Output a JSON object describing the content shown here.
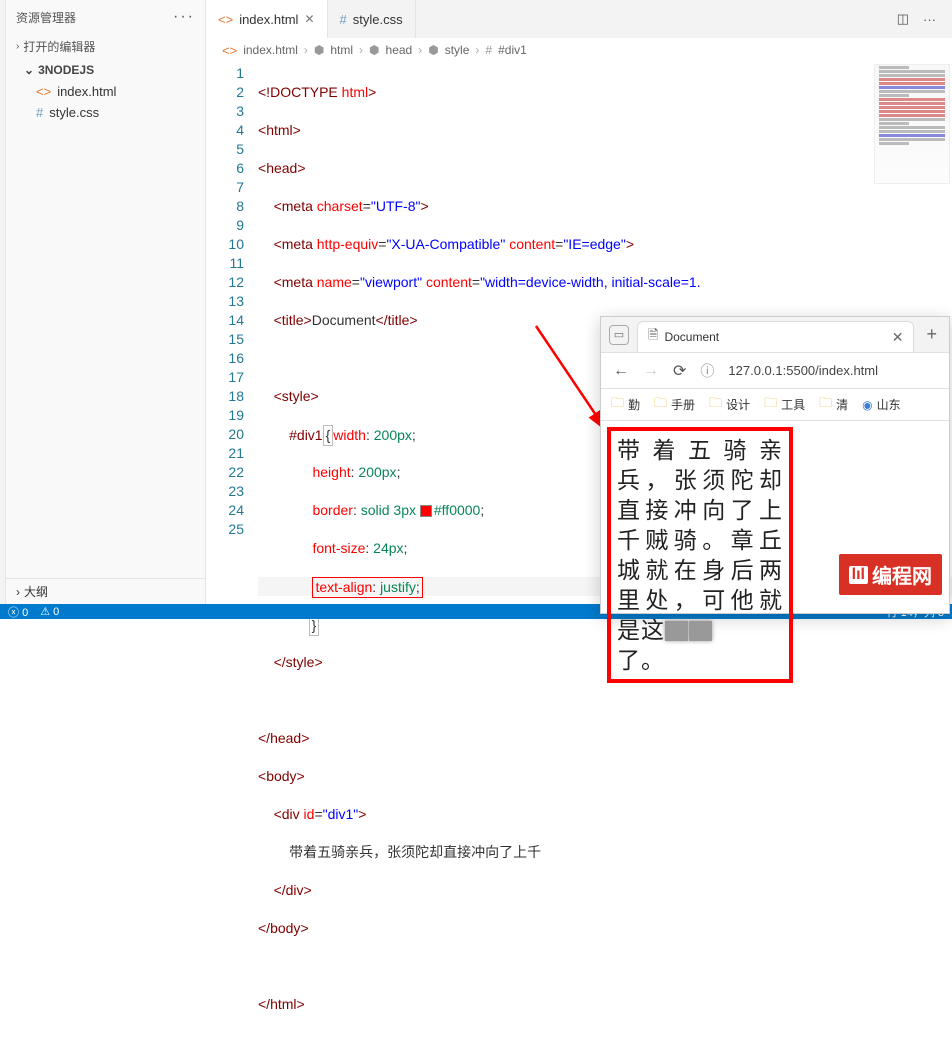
{
  "sidebar": {
    "title": "资源管理器",
    "open_editors": "打开的编辑器",
    "folder": "3NODEJS",
    "files": [
      {
        "name": "index.html",
        "icon": "<>"
      },
      {
        "name": "style.css",
        "icon": "#"
      }
    ],
    "outline": "大纲"
  },
  "tabs": [
    {
      "label": "index.html",
      "icon": "<>",
      "active": true
    },
    {
      "label": "style.css",
      "icon": "#",
      "active": false
    }
  ],
  "breadcrumb": [
    "index.html",
    "html",
    "head",
    "style",
    "#div1"
  ],
  "editor": {
    "code": {
      "l1": "<!DOCTYPE html>",
      "l2": "<html>",
      "l3": "<head>",
      "l4_meta_attr": "charset",
      "l4_meta_val": "\"UTF-8\"",
      "l5_attr1": "http-equiv",
      "l5_val1": "\"X-UA-Compatible\"",
      "l5_attr2": "content",
      "l5_val2": "\"IE=edge\"",
      "l6_attr1": "name",
      "l6_val1": "\"viewport\"",
      "l6_attr2": "content",
      "l6_val2": "\"width=device-width, initial-scale=1.",
      "l7_title": "Document",
      "l10_sel": "#div1",
      "l10_p": "width",
      "l10_v": "200px",
      "l11_p": "height",
      "l11_v": "200px",
      "l12_p": "border",
      "l12_v1": "solid",
      "l12_v2": "3px",
      "l12_v3": "#ff0000",
      "l13_p": "font-size",
      "l13_v": "24px",
      "l14_p": "text-align",
      "l14_v": "justify",
      "l20_attr": "id",
      "l20_val": "\"div1\"",
      "l21_text": "带着五骑亲兵，张须陀却直接冲向了上千"
    }
  },
  "browser": {
    "tab_title": "Document",
    "url": "127.0.0.1:5500/index.html",
    "bookmarks": [
      "勤",
      "手册",
      "设计",
      "工具",
      "清",
      "山东"
    ],
    "content": "带着五骑亲兵，张须陀却直接冲向了上千贼骑。章丘城就在身后两里处，可他就是这",
    "content_last": "了。"
  },
  "statusbar": {
    "errors": "0",
    "warnings": "0",
    "cursor": "行 14，列 3"
  },
  "logo": {
    "text": "编程网"
  }
}
